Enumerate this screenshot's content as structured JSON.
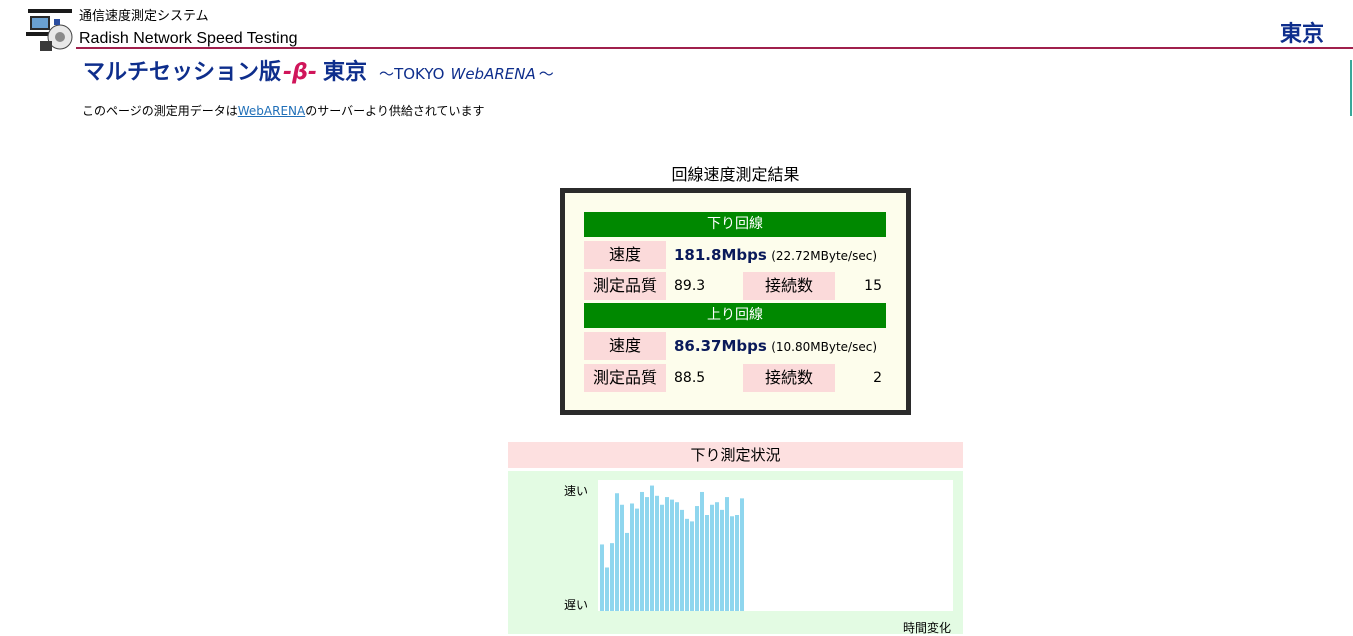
{
  "header": {
    "subtitle_jp": "通信速度測定システム",
    "subtitle_en": "Radish Network Speed Testing",
    "region": "東京"
  },
  "title": {
    "main": "マルチセッション版",
    "beta": "-β-",
    "city": "東京",
    "tilde_open": "〜",
    "tokyo": "TOKYO",
    "webarena": "WebARENA",
    "tilde_close": "〜"
  },
  "info": {
    "prefix": "このページの測定用データは",
    "link": "WebARENA",
    "suffix": "のサーバーより供給されています"
  },
  "results": {
    "title": "回線速度測定結果",
    "download": {
      "heading": "下り回線",
      "speed_label": "速度",
      "speed": "181.8Mbps",
      "speed_detail": "(22.72MByte/sec)",
      "quality_label": "測定品質",
      "quality": "89.3",
      "connections_label": "接続数",
      "connections": "15"
    },
    "upload": {
      "heading": "上り回線",
      "speed_label": "速度",
      "speed": "86.37Mbps",
      "speed_detail": "(10.80MByte/sec)",
      "quality_label": "測定品質",
      "quality": "88.5",
      "connections_label": "接続数",
      "connections": "2"
    }
  },
  "status": {
    "heading": "下り測定状況",
    "fast_label": "速い",
    "slow_label": "遅い",
    "time_label": "時間変化"
  },
  "chart_data": {
    "type": "bar",
    "ylabel_top": "速い",
    "ylabel_bottom": "遅い",
    "xlabel": "時間変化",
    "ylim": [
      0,
      100
    ],
    "values": [
      52,
      34,
      53,
      92,
      83,
      61,
      84,
      80,
      93,
      89,
      98,
      90,
      83,
      89,
      87,
      85,
      79,
      72,
      70,
      82,
      93,
      75,
      83,
      85,
      79,
      89,
      74,
      75,
      88
    ],
    "bar_color": "#8fd6ee"
  },
  "colors": {
    "brand_blue": "#0e2e8c",
    "accent_red": "#d0155a",
    "section_green": "#008800",
    "label_pink": "#fbdada",
    "panel_green": "#e3fbe3"
  }
}
